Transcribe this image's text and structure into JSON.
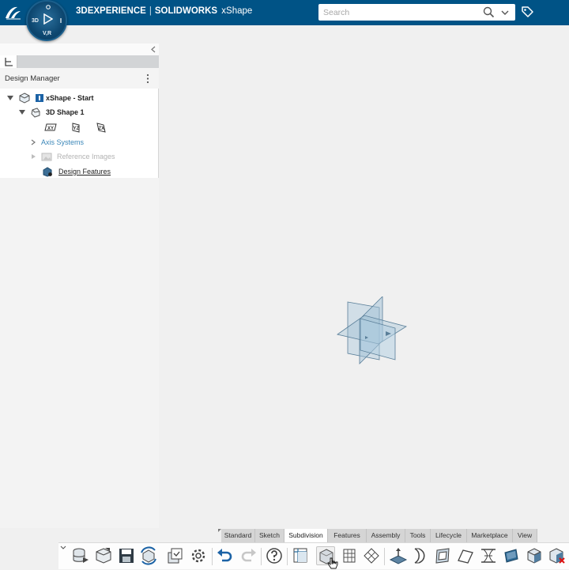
{
  "header": {
    "brand_bold_1": "3DEXPERIENCE",
    "brand_separator": "|",
    "brand_bold_2": "SOLIDWORKS",
    "app_name": "xShape",
    "compass_labels": {
      "left": "3D",
      "bottom": "V,R"
    },
    "search": {
      "placeholder": "Search",
      "value": ""
    },
    "accent_color": "#005386"
  },
  "design_manager": {
    "title": "Design Manager",
    "tree": [
      {
        "label": "xShape - Start",
        "level": 0,
        "expanded": true,
        "bold": true
      },
      {
        "label": "3D Shape 1",
        "level": 1,
        "expanded": true,
        "bold": true
      },
      {
        "planes": [
          "XY",
          "YZ",
          "ZX"
        ]
      },
      {
        "label": "Axis Systems",
        "level": 2,
        "expanded": false,
        "color": "#3a86b8"
      },
      {
        "label": "Reference Images",
        "level": 2,
        "expanded": false,
        "color": "#b3b3b3"
      },
      {
        "label": "Design Features",
        "level": 2,
        "underline": true
      }
    ]
  },
  "action_tabs": [
    {
      "label": "Standard",
      "active": false
    },
    {
      "label": "Sketch",
      "active": false
    },
    {
      "label": "Subdivision",
      "active": true
    },
    {
      "label": "Features",
      "active": false
    },
    {
      "label": "Assembly",
      "active": false
    },
    {
      "label": "Tools",
      "active": false
    },
    {
      "label": "Lifecycle",
      "active": false
    },
    {
      "label": "Marketplace",
      "active": false
    },
    {
      "label": "View",
      "active": false
    }
  ],
  "toolbar_icons": [
    "database-icon",
    "cube-open-icon",
    "save-icon",
    "refresh-icon",
    "share-icon",
    "settings-icon",
    "undo-icon",
    "redo-icon",
    "help-icon",
    "subdivision-box-icon",
    "cube-wireframe-icon",
    "grid-plane-icon",
    "diamond-mesh-icon",
    "sweep-icon",
    "curves-icon",
    "boundary-surface-icon",
    "tilt-surface-icon",
    "bridge-icon",
    "extrude-face-icon",
    "box-solid-icon",
    "delete-box-icon"
  ]
}
